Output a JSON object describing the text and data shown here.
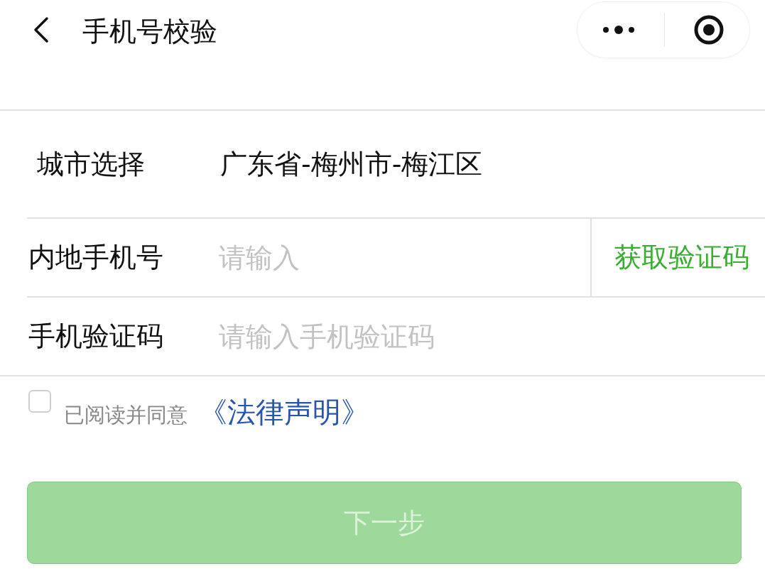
{
  "header": {
    "title": "手机号校验"
  },
  "form": {
    "rows": [
      {
        "kind": "select",
        "label": "城市选择",
        "value": "广东省-梅州市-梅江区"
      },
      {
        "kind": "input",
        "label": "内地手机号",
        "placeholder": "请输入",
        "action": "获取验证码"
      },
      {
        "kind": "input",
        "label": "手机验证码",
        "placeholder": "请输入手机验证码"
      }
    ]
  },
  "agreement": {
    "checked": false,
    "text": "已阅读并同意",
    "link": "《法律声明》"
  },
  "submit": {
    "label": "下一步",
    "disabled": true
  }
}
